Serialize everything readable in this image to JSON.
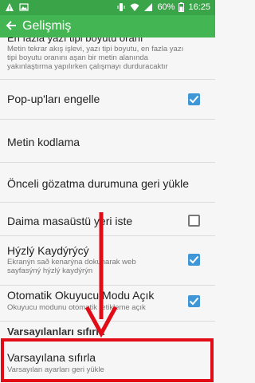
{
  "status_bar": {
    "battery": "60%",
    "time": "16:25",
    "icons": [
      "warning-icon",
      "image-icon",
      "wifi-icon",
      "vibrate-icon",
      "signal-icon",
      "battery-icon"
    ]
  },
  "action_bar": {
    "title": "Gelişmiş",
    "back_icon": "back-arrow-icon"
  },
  "settings": {
    "top_partial": {
      "title": "En fazla yazı tipi boyutu oranı",
      "summary": "Metin tekrar akış işlevi, yazı tipi boyutu, en fazla yazı tipi boyutu oranını aşan bir metin alanında yakınlaştırma yapılırken çalışmayı durduracaktır"
    },
    "popup_block": {
      "title": "Pop-up'ları engelle",
      "checked": true
    },
    "text_encoding": {
      "title": "Metin kodlama"
    },
    "restore_browsing": {
      "title": "Önceli gözatma durumuna geri yükle"
    },
    "desktop_site": {
      "title": "Daima masaüstü yeri iste",
      "checked": false
    },
    "quick_scroll": {
      "title": "Hýzlý Kaydýrýcý",
      "summary": "Ekranýn sað kenarýna dokunarak web sayfasýný hýzlý kaydýrýn",
      "checked": true
    },
    "auto_reader": {
      "title": "Otomatik Okuyucu Modu Açık",
      "summary": "Okuyucu modunu otomatik tetikleme açık",
      "checked": true
    },
    "section_defaults": {
      "label": "Varsayılanları sıfırla"
    },
    "reset_defaults": {
      "title": "Varsayılana sıfırla",
      "summary": "Varsayılan ayarları geri yükle"
    }
  },
  "colors": {
    "status_bar": "#3aa548",
    "action_bar": "#43b552",
    "checkbox_on": "#3f97d8",
    "annotation": "#e10c16"
  }
}
